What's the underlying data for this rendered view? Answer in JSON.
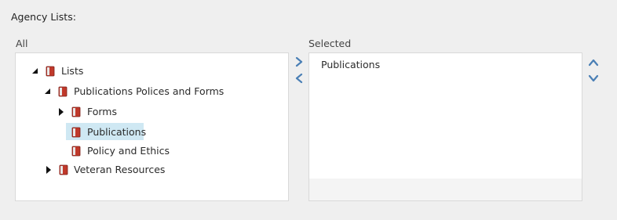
{
  "section": {
    "label": "Agency Lists:"
  },
  "all": {
    "label": "All",
    "tree": [
      {
        "label": "Lists",
        "toggle": "expanded",
        "level": 0
      },
      {
        "label": "Publications Polices and Forms",
        "toggle": "expanded",
        "level": 1
      },
      {
        "label": "Forms",
        "toggle": "collapsed",
        "level": 2
      },
      {
        "label": "Publications",
        "toggle": "none",
        "level": 2,
        "selected": true
      },
      {
        "label": "Policy and Ethics",
        "toggle": "none",
        "level": 2
      },
      {
        "label": "Veteran Resources",
        "toggle": "collapsed",
        "level": 1
      }
    ]
  },
  "selected": {
    "label": "Selected",
    "items": [
      {
        "label": "Publications"
      }
    ]
  },
  "controls": {
    "add_icon": "chevron-right-icon",
    "remove_icon": "chevron-left-icon",
    "move_up_icon": "chevron-up-icon",
    "move_down_icon": "chevron-down-icon",
    "accent_color": "#4a7fb5"
  },
  "colors": {
    "background": "#efefef",
    "selection": "#cfe8f3",
    "book_red": "#c0392b"
  }
}
